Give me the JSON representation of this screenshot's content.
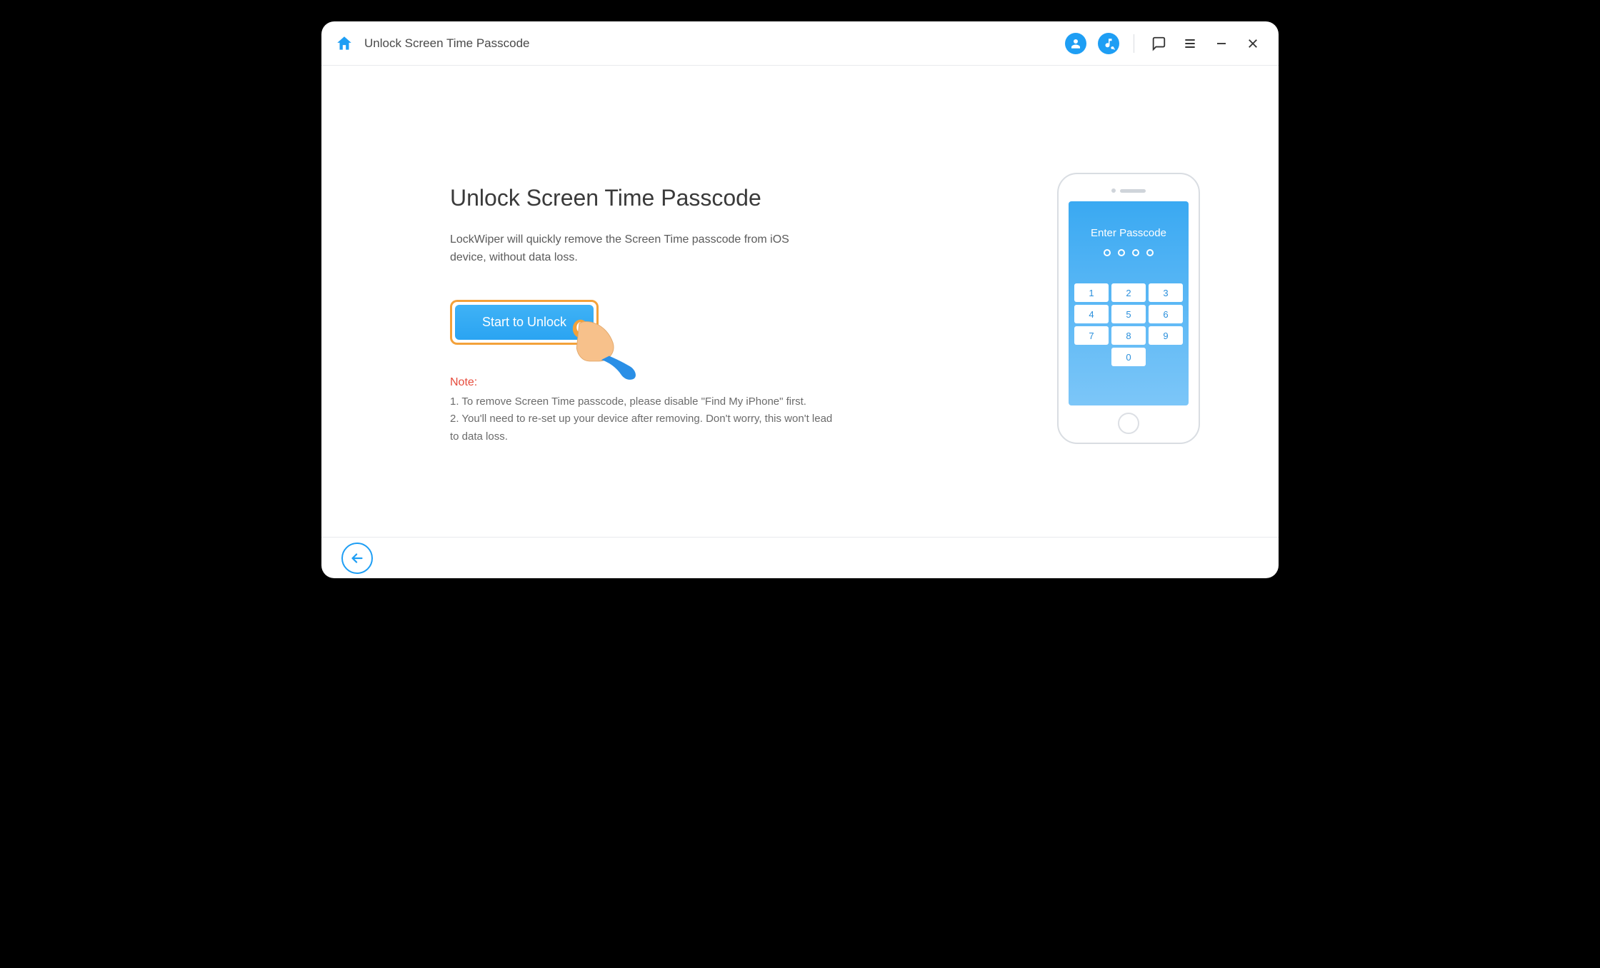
{
  "titlebar": {
    "title": "Unlock Screen Time Passcode"
  },
  "main": {
    "heading": "Unlock Screen Time Passcode",
    "description": "LockWiper will quickly remove the Screen Time passcode from iOS device, without data loss.",
    "cta_label": "Start to Unlock",
    "note_label": "Note:",
    "notes": [
      "1. To remove Screen Time passcode, please disable \"Find My iPhone\" first.",
      "2. You'll need to re-set up your device after removing. Don't worry, this won't lead to data loss."
    ]
  },
  "phone": {
    "screen_title": "Enter Passcode",
    "keys": [
      "1",
      "2",
      "3",
      "4",
      "5",
      "6",
      "7",
      "8",
      "9",
      "0"
    ]
  }
}
